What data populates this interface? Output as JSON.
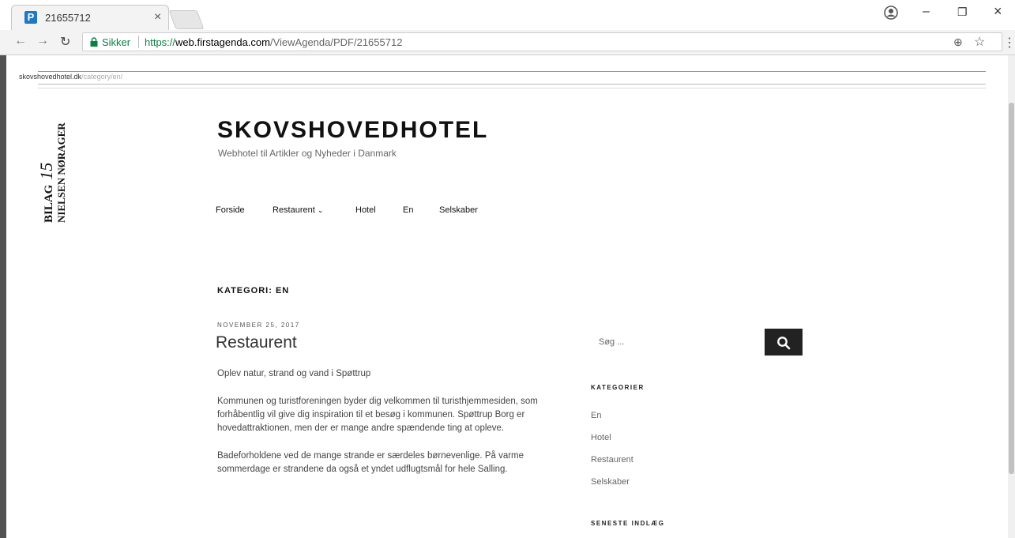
{
  "browser": {
    "tab_title": "21655712",
    "secure_label": "Sikker",
    "url_scheme": "https://",
    "url_host": "web.firstagenda.com",
    "url_path": "/ViewAgenda/PDF/21655712"
  },
  "pdf": {
    "print_header_host": "skovshovedhotel.dk",
    "print_header_path": "/category/en/",
    "stamp_line1": "BILAG",
    "stamp_number": "15",
    "stamp_line2": "NIELSEN NØRAGER",
    "site_title": "SKOVSHOVEDHOTEL",
    "site_tagline": "Webhotel til Artikler og Nyheder i Danmark",
    "nav": [
      {
        "label": "Forside"
      },
      {
        "label": "Restaurent"
      },
      {
        "label": "Hotel"
      },
      {
        "label": "En"
      },
      {
        "label": "Selskaber"
      }
    ],
    "archive_title": "KATEGORI: EN",
    "post": {
      "date": "NOVEMBER 25, 2017",
      "title": "Restaurent",
      "paragraphs": [
        "Oplev natur, strand og vand i Spøttrup",
        "Kommunen og turistforeningen byder dig velkommen til turisthjemmesiden, som forhåbentlig vil give dig inspiration til et besøg i kommunen. Spøttrup Borg er hovedattraktionen, men der er mange andre spændende ting at opleve.",
        "Badeforholdene ved de mange strande er særdeles børnevenlige. På varme sommerdage er strandene da også et yndet udflugtsmål for hele Salling."
      ]
    },
    "sidebar": {
      "search_placeholder": "Søg ...",
      "categories_title": "KATEGORIER",
      "categories": [
        "En",
        "Hotel",
        "Restaurent",
        "Selskaber"
      ],
      "recent_title": "SENESTE INDLÆG"
    }
  },
  "icons": {
    "favicon": "firstagenda-p-logo",
    "lock": "lock-icon",
    "search": "search-icon"
  },
  "colors": {
    "secure_green": "#0b8043",
    "favicon_blue": "#1f78c1",
    "search_button": "#222222"
  }
}
